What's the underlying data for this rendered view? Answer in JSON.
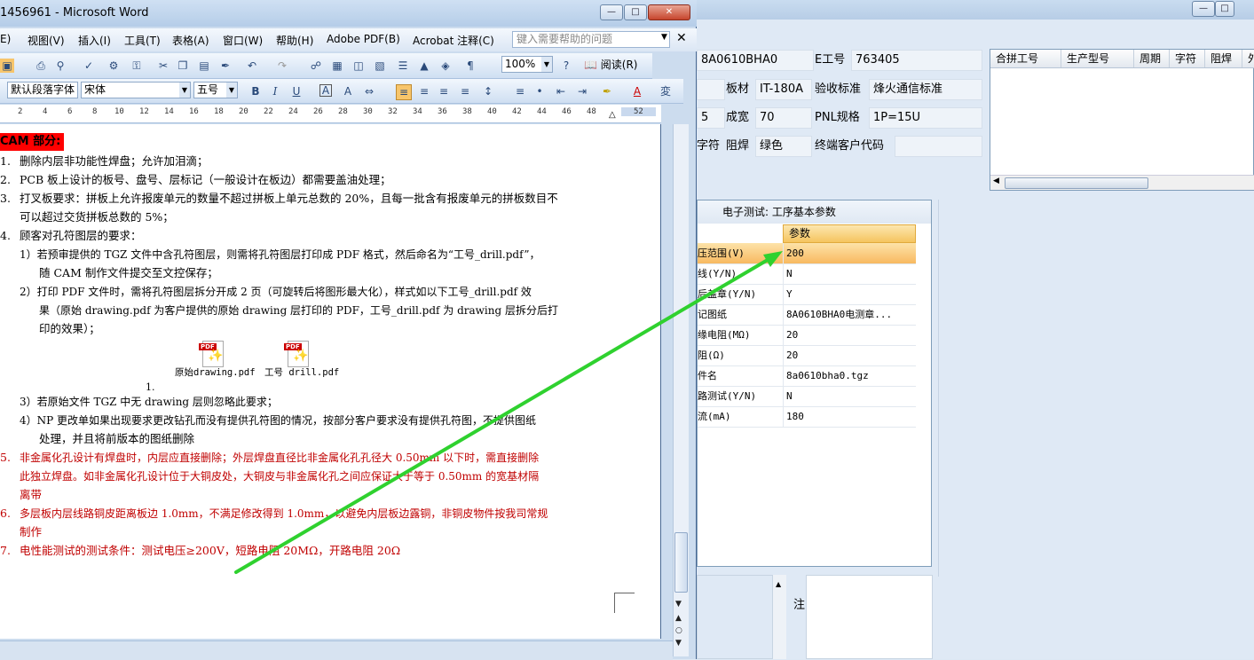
{
  "app": {
    "menu_right": "▴▫",
    "form": {
      "part_no_value": "8A0610BHA0",
      "e_job_label": "E工号",
      "e_job_value": "763405",
      "material_label": "板材",
      "material_value": "IT-180A",
      "acceptance_label": "验收标准",
      "acceptance_value": "烽火通信标准",
      "row3_left_value": "5",
      "finished_width_label": "成宽",
      "finished_width_value": "70",
      "pnl_label": "PNL规格",
      "pnl_value": "1P=15U",
      "char_label": "字符",
      "mask_label": "阻焊",
      "mask_value": "绿色",
      "end_customer_label": "终端客户代码",
      "end_customer_value": ""
    },
    "grid_headers": [
      "合拼工号",
      "生产型号",
      "周期",
      "字符",
      "阻焊",
      "外"
    ],
    "params": {
      "title": "电子测试: 工序基本参数",
      "header": "参数",
      "rows": [
        {
          "name": "压范围(V)",
          "value": "200"
        },
        {
          "name": "线(Y/N)",
          "value": "N"
        },
        {
          "name": "后盖章(Y/N)",
          "value": "Y"
        },
        {
          "name": "记图纸",
          "value": "8A0610BHA0电测章..."
        },
        {
          "name": "缘电阻(MΩ)",
          "value": "20"
        },
        {
          "name": "阻(Ω)",
          "value": "20"
        },
        {
          "name": "件名",
          "value": "8a0610bha0.tgz"
        },
        {
          "name": "路测试(Y/N)",
          "value": "N"
        },
        {
          "name": "流(mA)",
          "value": "180"
        }
      ]
    },
    "bottom_label": "型号备注"
  },
  "word": {
    "title": "1456961 - Microsoft Word",
    "menu": [
      "E)",
      "视图(V)",
      "插入(I)",
      "工具(T)",
      "表格(A)",
      "窗口(W)",
      "帮助(H)",
      "Adobe PDF(B)",
      "Acrobat 注释(C)"
    ],
    "help_placeholder": "键入需要帮助的问题",
    "zoom": "100%",
    "read_label": "阅读(R)",
    "style": "默认段落字体",
    "font": "宋体",
    "size": "五号",
    "ruler_numbers": [
      "2",
      "4",
      "6",
      "8",
      "10",
      "12",
      "14",
      "16",
      "18",
      "20",
      "22",
      "24",
      "26",
      "28",
      "30",
      "32",
      "34",
      "36",
      "38",
      "40",
      "42",
      "44",
      "46",
      "48",
      "52"
    ],
    "doc": {
      "heading": "CAM 部分:",
      "items": [
        {
          "num": "1.",
          "text": "删除内层非功能性焊盘；允许加泪滴；"
        },
        {
          "num": "2.",
          "text": "PCB 板上设计的板号、盘号、层标记（一般设计在板边）都需要盖油处理；"
        },
        {
          "num": "3.",
          "text": "打叉板要求：拼板上允许报废单元的数量不超过拼板上单元总数的 20%，且每一批含有报废单元的拼板数目不",
          "cont": "可以超过交货拼板总数的 5%；"
        },
        {
          "num": "4.",
          "text": "顾客对孔符图层的要求："
        }
      ],
      "sub1": "1）若预审提供的 TGZ 文件中含孔符图层，则需将孔符图层打印成 PDF 格式，然后命名为“工号_drill.pdf”，",
      "sub1b": "随 CAM 制作文件提交至文控保存；",
      "sub2": "2）打印 PDF 文件时，需将孔符图层拆分开成 2 页（可旋转后将图形最大化），样式如以下工号_drill.pdf 效",
      "sub2b": "果（原始 drawing.pdf 为客户提供的原始 drawing 层打印的 PDF，工号_drill.pdf 为 drawing 层拆分后打",
      "sub2c": "印的效果）；",
      "pdf1": "原始drawing.pdf",
      "pdf2": "工号 drill.pdf",
      "numbered_one": "1.",
      "sub3": "3）若原始文件 TGZ 中无 drawing 层则忽略此要求；",
      "sub4": "4）NP 更改单如果出现要求更改钻孔而没有提供孔符图的情况，按部分客户要求没有提供孔符图，不提供图纸",
      "sub4b": "处理，并且将前版本的图纸删除",
      "item5": "非金属化孔设计有焊盘时，内层应直接删除；外层焊盘直径比非金属化孔孔径大 0.50mm 以下时，需直接删除",
      "item5b": "此独立焊盘。如非金属化孔设计位于大铜皮处，大铜皮与非金属化孔之间应保证大于等于 0.50mm 的宽基材隔",
      "item5c": "离带",
      "item6": "多层板内层线路铜皮距离板边 1.0mm，不满足修改得到 1.0mm，以避免内层板边露铜，非铜皮物件按我司常规",
      "item6b": "制作",
      "item7": "电性能测试的测试条件：测试电压≥200V，短路电阻 20MΩ，开路电阻 20Ω"
    }
  }
}
